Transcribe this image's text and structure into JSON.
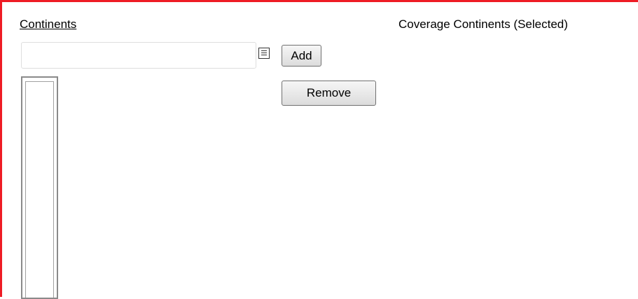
{
  "available": {
    "link_label": "Continents",
    "search_value": "",
    "items": []
  },
  "actions": {
    "add_label": "Add",
    "remove_label": "Remove"
  },
  "selected": {
    "label": "Coverage Continents (Selected)",
    "items": []
  },
  "icons": {
    "lookup": "list-lookup-icon"
  },
  "colors": {
    "frame_border": "#ee1c25"
  }
}
